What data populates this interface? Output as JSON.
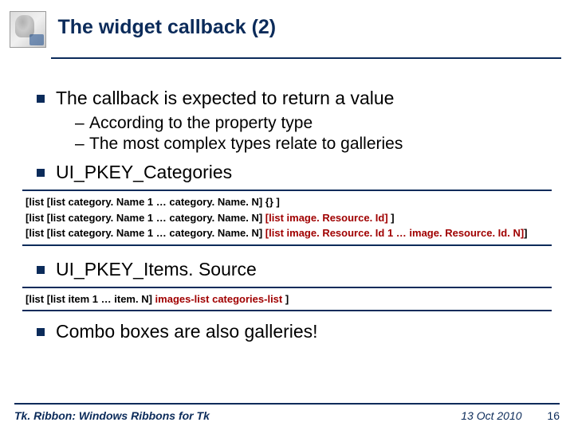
{
  "header": {
    "title": "The widget callback (2)"
  },
  "bullets": {
    "b1": "The callback is expected to return a value",
    "b1a": "According to the property type",
    "b1b": "The most complex types relate to galleries",
    "b2": "UI_PKEY_Categories",
    "b3": "UI_PKEY_Items. Source",
    "b4": "Combo boxes are also galleries!"
  },
  "code1": {
    "l1_pre": "[list  ",
    "l1_mid": "[list category. Name 1 … category. Name. N]  ",
    "l1_post": "{} ]",
    "l2_pre": "[list  ",
    "l2_mid": "[list category. Name 1 … category. Name. N]  ",
    "l2_kw": "[list  image. Resource. Id]",
    "l2_post": " ]",
    "l3_pre": "[list  ",
    "l3_mid": "[list category. Name 1 … category. Name. N]  ",
    "l3_kw": "[list  image. Resource. Id 1 … image. Resource. Id. N]",
    "l3_post": "]"
  },
  "code2": {
    "pre": "[list ",
    "mid": "[list item 1 … item. N] ",
    "kw1": "images-list",
    "sep": "  ",
    "kw2": "categories-list",
    "post": " ]"
  },
  "footer": {
    "left": "Tk. Ribbon: Windows Ribbons for Tk",
    "date": "13 Oct 2010",
    "page": "16"
  }
}
